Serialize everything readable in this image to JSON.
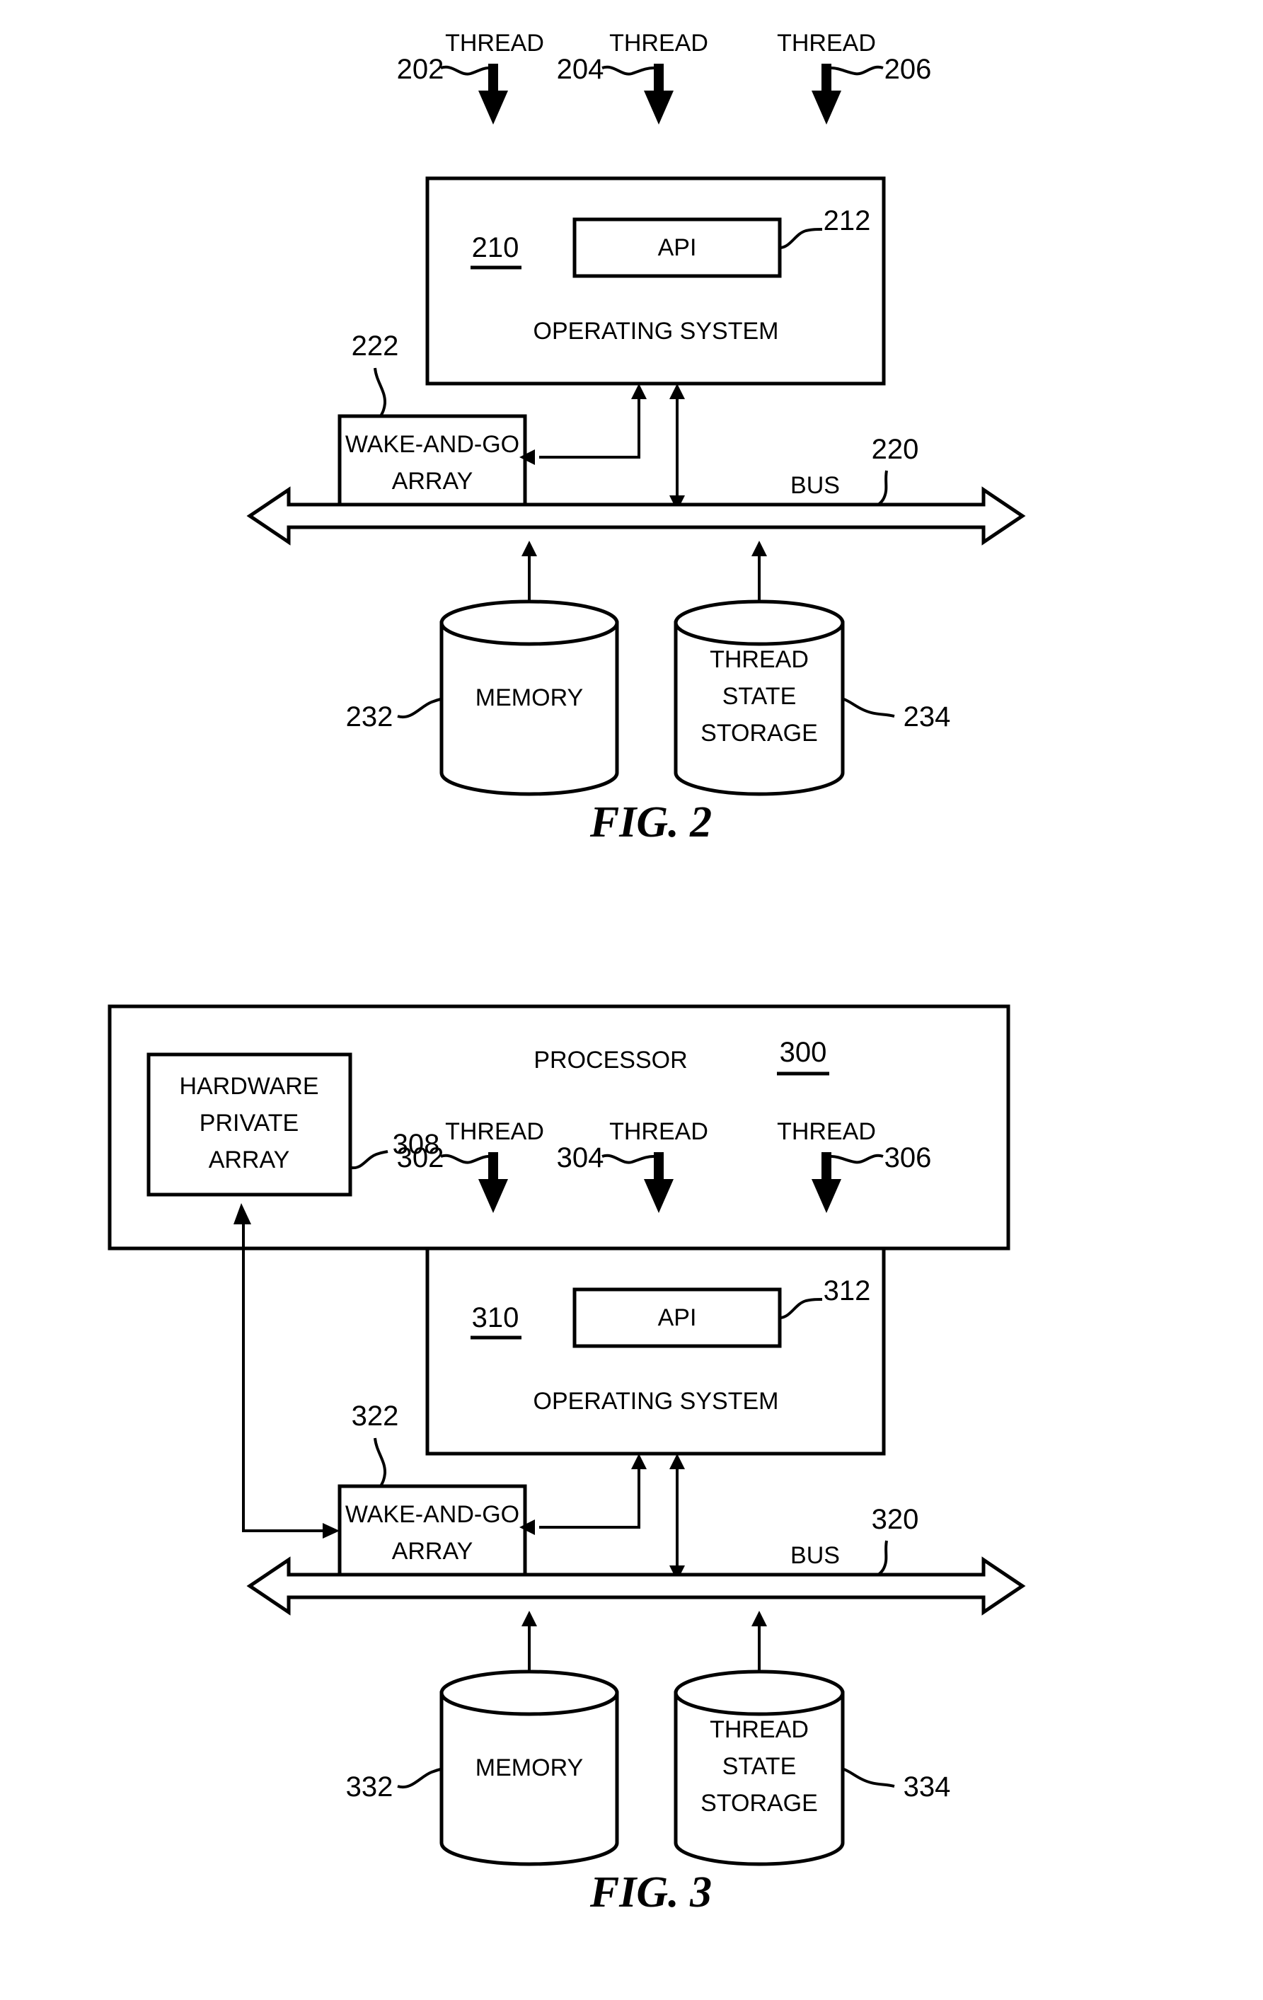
{
  "document": {
    "type": "patent-drawing-sheet",
    "figures": [
      "FIG. 2",
      "FIG. 3"
    ]
  },
  "fig2": {
    "caption": "FIG. 2",
    "threads": [
      {
        "label": "THREAD",
        "ref": "202"
      },
      {
        "label": "THREAD",
        "ref": "204"
      },
      {
        "label": "THREAD",
        "ref": "206"
      }
    ],
    "os_box": {
      "ref": "210",
      "title": "OPERATING SYSTEM",
      "api": {
        "label": "API",
        "ref": "212"
      }
    },
    "wake_and_go": {
      "line1": "WAKE-AND-GO",
      "line2": "ARRAY",
      "ref": "222"
    },
    "bus": {
      "label": "BUS",
      "ref": "220"
    },
    "memory": {
      "label": "MEMORY",
      "ref": "232"
    },
    "thread_state_storage": {
      "line1": "THREAD",
      "line2": "STATE",
      "line3": "STORAGE",
      "ref": "234"
    }
  },
  "fig3": {
    "caption": "FIG. 3",
    "processor": {
      "label": "PROCESSOR",
      "ref": "300"
    },
    "hardware_private_array": {
      "line1": "HARDWARE",
      "line2": "PRIVATE",
      "line3": "ARRAY",
      "ref": "308"
    },
    "threads": [
      {
        "label": "THREAD",
        "ref": "302"
      },
      {
        "label": "THREAD",
        "ref": "304"
      },
      {
        "label": "THREAD",
        "ref": "306"
      }
    ],
    "os_box": {
      "ref": "310",
      "title": "OPERATING SYSTEM",
      "api": {
        "label": "API",
        "ref": "312"
      }
    },
    "wake_and_go": {
      "line1": "WAKE-AND-GO",
      "line2": "ARRAY",
      "ref": "322"
    },
    "bus": {
      "label": "BUS",
      "ref": "320"
    },
    "memory": {
      "label": "MEMORY",
      "ref": "332"
    },
    "thread_state_storage": {
      "line1": "THREAD",
      "line2": "STATE",
      "line3": "STORAGE",
      "ref": "334"
    }
  },
  "colors": {
    "ink": "#000000",
    "paper": "#ffffff"
  }
}
